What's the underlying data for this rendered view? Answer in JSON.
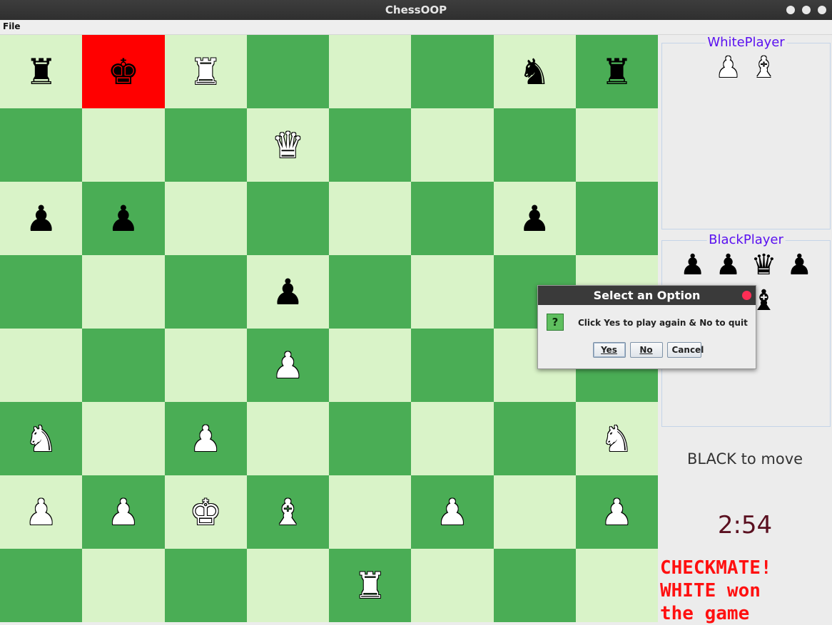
{
  "window": {
    "title": "ChessOOP"
  },
  "menu": {
    "file_label": "File"
  },
  "board": {
    "highlight_square": "b8",
    "rows": [
      [
        "bR",
        "bK",
        "wR",
        "",
        "",
        "",
        "bN",
        "bR"
      ],
      [
        "",
        "",
        "",
        "wQ",
        "",
        "",
        "",
        ""
      ],
      [
        "bP",
        "bP",
        "",
        "",
        "",
        "",
        "bP",
        ""
      ],
      [
        "",
        "",
        "",
        "bP",
        "",
        "",
        "",
        ""
      ],
      [
        "",
        "",
        "",
        "wP",
        "",
        "",
        "",
        ""
      ],
      [
        "wN",
        "",
        "wP",
        "",
        "",
        "",
        "",
        "wN"
      ],
      [
        "wP",
        "wP",
        "wK",
        "wB",
        "",
        "wP",
        "",
        "wP"
      ],
      [
        "",
        "",
        "",
        "",
        "wR",
        "",
        "",
        ""
      ]
    ]
  },
  "sidebar": {
    "white_player_label": "WhitePlayer",
    "black_player_label": "BlackPlayer",
    "white_captured": [
      "wP",
      "wB"
    ],
    "black_captured": [
      "bP",
      "bP",
      "bQ",
      "bP",
      "bP",
      "bB"
    ],
    "to_move_text": "BLACK to move",
    "timer": "2:54",
    "result_line1": "CHECKMATE!",
    "result_line2": "WHITE won",
    "result_line3": "the game"
  },
  "dialog": {
    "title": "Select an Option",
    "icon": "question-icon",
    "message": "Click Yes to play again & No to quit",
    "yes_label": "Yes",
    "no_label": "No",
    "cancel_label": "Cancel"
  },
  "colors": {
    "light_square": "#d9f3c8",
    "dark_square": "#4aad55",
    "highlight": "#ff0000",
    "player_label": "#5a11f0",
    "result_text": "#ff1010"
  }
}
